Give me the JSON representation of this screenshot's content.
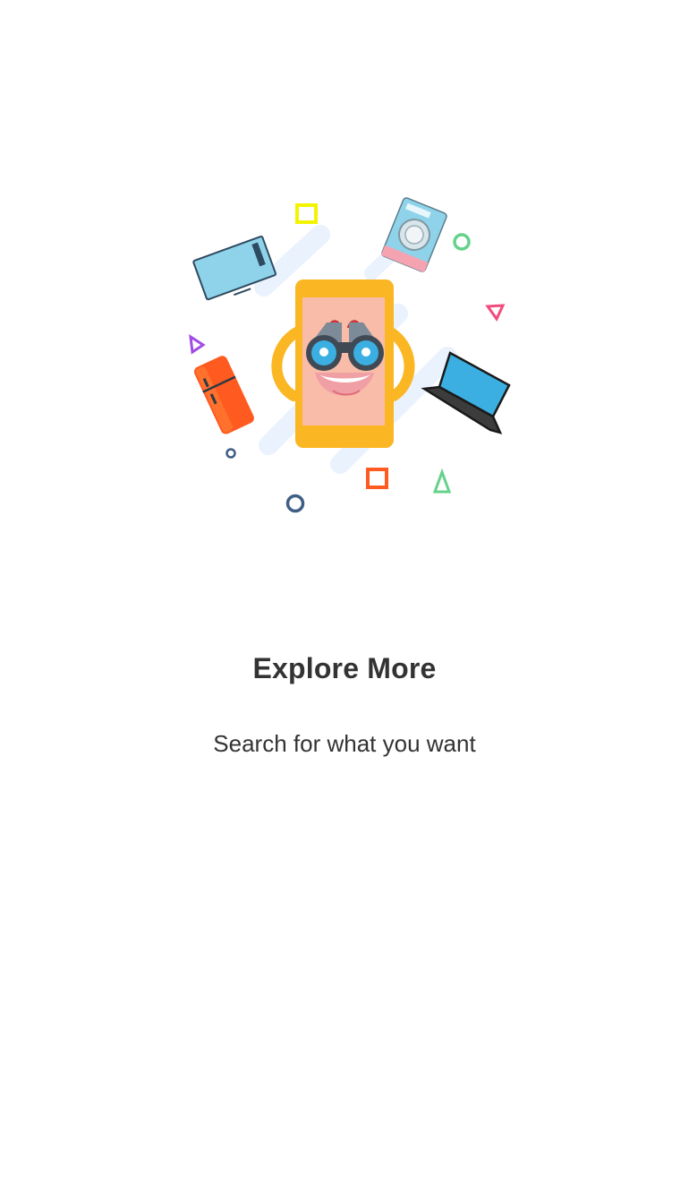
{
  "onboarding": {
    "title": "Explore More",
    "subtitle": "Search for what you want"
  },
  "illustration": {
    "items": [
      "tv-icon",
      "washing-machine-icon",
      "fridge-icon",
      "laptop-icon",
      "phone-mascot-icon",
      "binoculars-icon"
    ],
    "colors": {
      "phone": "#FBB623",
      "screen": "#F9BCA8",
      "accent_blue": "#3BAFE1",
      "streak": "#EAF2FD",
      "fridge": "#FF5A1F",
      "text": "#333333"
    }
  }
}
